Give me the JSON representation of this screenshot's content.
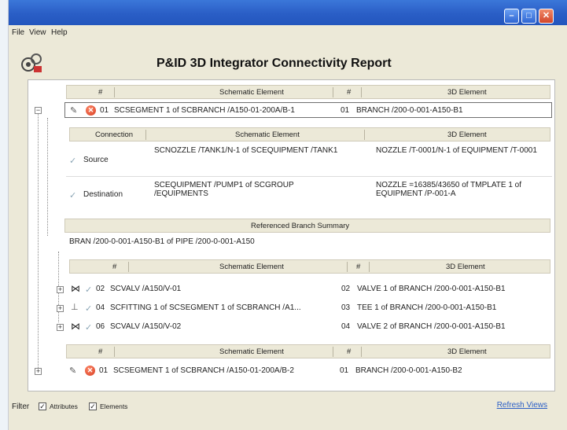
{
  "menu": [
    "File",
    "View",
    "Help"
  ],
  "title": "P&ID 3D Integrator Connectivity Report",
  "columns": {
    "num": "#",
    "schematic": "Schematic Element",
    "element3d": "3D Element"
  },
  "segment1": {
    "num": "01",
    "schematic": "SCSEGMENT 1 of SCBRANCH /A150-01-200A/B-1",
    "num3d": "01",
    "element3d": "BRANCH /200-0-001-A150-B1"
  },
  "connection_headers": {
    "connection": "Connection",
    "schematic": "Schematic Element",
    "element3d": "3D Element"
  },
  "connections": [
    {
      "type": "Source",
      "schematic": "SCNOZZLE /TANK1/N-1 of SCEQUIPMENT /TANK1",
      "element3d": "NOZZLE /T-0001/N-1 of EQUIPMENT /T-0001"
    },
    {
      "type": "Destination",
      "schematic": "SCEQUIPMENT /PUMP1 of SCGROUP /EQUIPMENTS",
      "element3d": "NOZZLE =16385/43650 of TMPLATE 1 of EQUIPMENT /P-001-A"
    }
  ],
  "ref_summary_title": "Referenced Branch Summary",
  "ref_summary_text": "BRAN /200-0-001-A150-B1 of PIPE /200-0-001-A150",
  "sub_rows": [
    {
      "icon": "valve-icon",
      "num": "02",
      "schematic": "SCVALV /A150/V-01",
      "num3d": "02",
      "element3d": "VALVE 1 of BRANCH /200-0-001-A150-B1"
    },
    {
      "icon": "tee-icon",
      "num": "04",
      "schematic": "SCFITTING 1 of SCSEGMENT 1 of SCBRANCH /A1...",
      "num3d": "03",
      "element3d": "TEE 1 of BRANCH /200-0-001-A150-B1"
    },
    {
      "icon": "valve-icon",
      "num": "06",
      "schematic": "SCVALV /A150/V-02",
      "num3d": "04",
      "element3d": "VALVE 2 of BRANCH /200-0-001-A150-B1"
    }
  ],
  "segment2": {
    "num": "01",
    "schematic": "SCSEGMENT 1 of SCBRANCH /A150-01-200A/B-2",
    "num3d": "01",
    "element3d": "BRANCH /200-0-001-A150-B2"
  },
  "filter": {
    "label": "Filter",
    "attributes": "Attributes",
    "elements": "Elements"
  },
  "refresh": "Refresh Views"
}
